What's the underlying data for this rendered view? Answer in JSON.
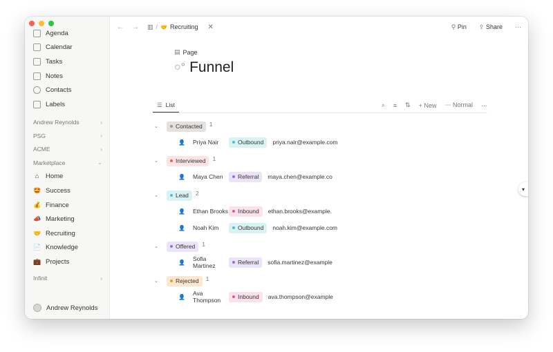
{
  "sidebar": {
    "items": [
      {
        "label": "Agenda",
        "icon": "agenda-icon"
      },
      {
        "label": "Calendar",
        "icon": "calendar-icon"
      },
      {
        "label": "Tasks",
        "icon": "tasks-icon"
      },
      {
        "label": "Notes",
        "icon": "notes-icon"
      },
      {
        "label": "Contacts",
        "icon": "contacts-icon"
      },
      {
        "label": "Labels",
        "icon": "labels-icon"
      }
    ],
    "groups": [
      {
        "label": "Andrew Reynolds"
      },
      {
        "label": "PSG"
      },
      {
        "label": "ACME"
      },
      {
        "label": "Marketplace"
      }
    ],
    "marketplace_items": [
      {
        "label": "Home",
        "icon": "home-icon",
        "glyph": "⌂"
      },
      {
        "label": "Success",
        "icon": "success-emoji-icon",
        "glyph": "🤩"
      },
      {
        "label": "Finance",
        "icon": "money-bag-icon",
        "glyph": "💰"
      },
      {
        "label": "Marketing",
        "icon": "megaphone-icon",
        "glyph": "📣"
      },
      {
        "label": "Recruiting",
        "icon": "handshake-icon",
        "glyph": "🤝"
      },
      {
        "label": "Knowledge",
        "icon": "document-icon",
        "glyph": "📄"
      },
      {
        "label": "Projects",
        "icon": "briefcase-icon",
        "glyph": "💼"
      }
    ],
    "infinit": {
      "label": "Infinit"
    },
    "footer_user": "Andrew Reynolds"
  },
  "topbar": {
    "breadcrumb_sep": "/",
    "breadcrumb_current": "Recruiting",
    "pin_label": "Pin",
    "share_label": "Share",
    "more_label": "···"
  },
  "page": {
    "label": "Page",
    "title": "Funnel"
  },
  "view": {
    "tab_label": "List",
    "new_label": "New",
    "density_label": "Normal",
    "more_label": "···"
  },
  "groups": [
    {
      "status": "Contacted",
      "count": "1",
      "color": "#e3e2e0",
      "dot": "#9b9a97",
      "rows": [
        {
          "name": "Priya Nair",
          "source": "Outbound",
          "email": "priya.nair@example.com"
        }
      ]
    },
    {
      "status": "Interviewed",
      "count": "1",
      "color": "#fbe4e4",
      "dot": "#e16259",
      "rows": [
        {
          "name": "Maya Chen",
          "source": "Referral",
          "email": "maya.chen@example.co"
        }
      ]
    },
    {
      "status": "Lead",
      "count": "2",
      "color": "#d9f3f4",
      "dot": "#4dc3c8",
      "rows": [
        {
          "name": "Ethan Brooks",
          "source": "Inbound",
          "email": "ethan.brooks@example."
        },
        {
          "name": "Noah Kim",
          "source": "Outbound",
          "email": "noah.kim@example.com"
        }
      ]
    },
    {
      "status": "Offered",
      "count": "1",
      "color": "#ebe3f8",
      "dot": "#9a6dd7",
      "rows": [
        {
          "name": "Sofia Martinez",
          "source": "Referral",
          "email": "sofia.martinez@example"
        }
      ]
    },
    {
      "status": "Rejected",
      "count": "1",
      "color": "#fde8cf",
      "dot": "#e39c3f",
      "rows": [
        {
          "name": "Ava Thompson",
          "source": "Inbound",
          "email": "ava.thompson@example"
        }
      ]
    }
  ],
  "source_colors": {
    "Outbound": {
      "bg": "#d9f3f4",
      "dot": "#4dc3c8"
    },
    "Referral": {
      "bg": "#ebe3f8",
      "dot": "#9a6dd7"
    },
    "Inbound": {
      "bg": "#f9e1ee",
      "dot": "#dd5a9b"
    }
  }
}
